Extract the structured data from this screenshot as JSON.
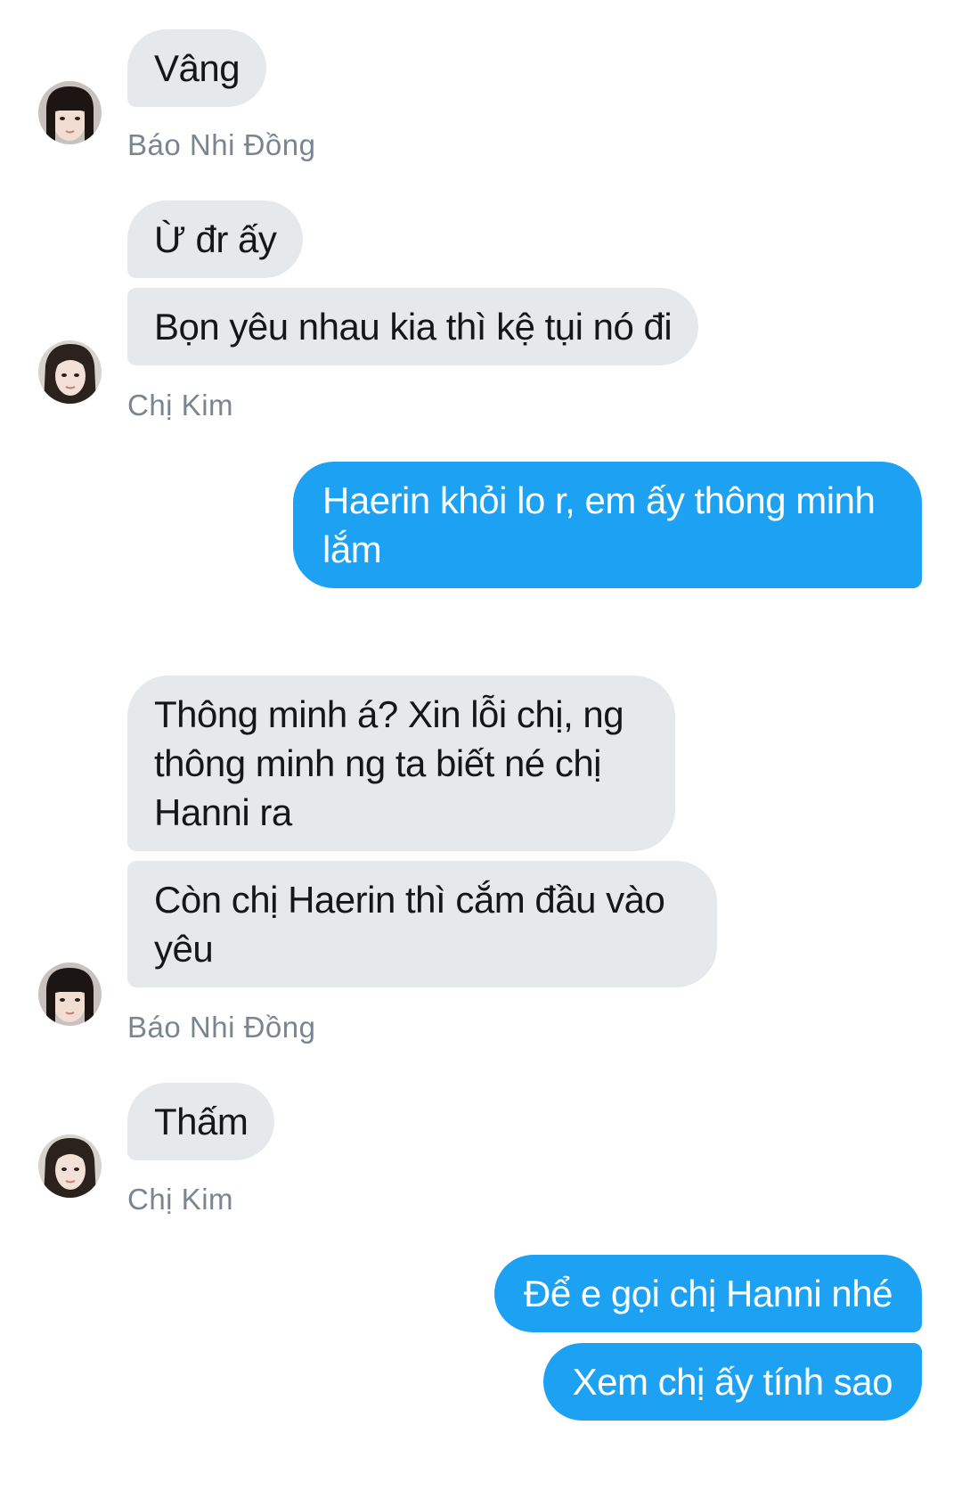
{
  "conversation": {
    "groups": [
      {
        "sender": "Báo Nhi Đồng",
        "avatar": "avatar-bangs-icon",
        "messages": [
          "Vâng"
        ]
      },
      {
        "sender": "Chị Kim",
        "avatar": "avatar-longhair-icon",
        "messages": [
          "Ừ đr ấy",
          "Bọn yêu nhau kia thì kệ tụi nó đi"
        ]
      },
      {
        "sender": "me",
        "messages": [
          "Haerin khỏi lo r, em ấy thông minh lắm"
        ]
      },
      {
        "sender": "Báo Nhi Đồng",
        "avatar": "avatar-bangs-icon",
        "messages": [
          "Thông minh á? Xin lỗi chị, ng thông minh ng ta biết né chị Hanni ra",
          "Còn chị Haerin thì cắm đầu vào yêu"
        ]
      },
      {
        "sender": "Chị Kim",
        "avatar": "avatar-longhair-icon",
        "messages": [
          "Thấm"
        ]
      },
      {
        "sender": "me",
        "messages": [
          "Để e gọi chị Hanni nhé",
          "Xem chị ấy tính sao"
        ]
      }
    ]
  },
  "colors": {
    "incoming_bubble": "#e6e9ec",
    "outgoing_bubble": "#1da1f2",
    "sender_name": "#7a8590"
  }
}
